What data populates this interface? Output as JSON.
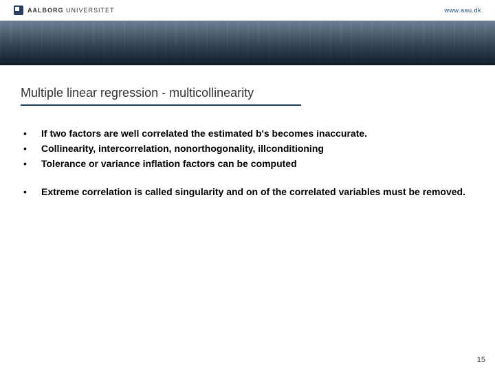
{
  "header": {
    "logo_strong": "AALBORG",
    "logo_light": "UNIVERSITET",
    "url": "www.aau.dk"
  },
  "slide": {
    "title": "Multiple linear regression - multicollinearity",
    "group1": [
      "If two factors are well correlated the estimated b's becomes inaccurate.",
      "Collinearity, intercorrelation, nonorthogonality, illconditioning",
      "Tolerance or variance inflation factors can be computed"
    ],
    "group2": [
      "Extreme correlation is called singularity and on of the correlated variables must be removed."
    ],
    "page_number": "15"
  }
}
